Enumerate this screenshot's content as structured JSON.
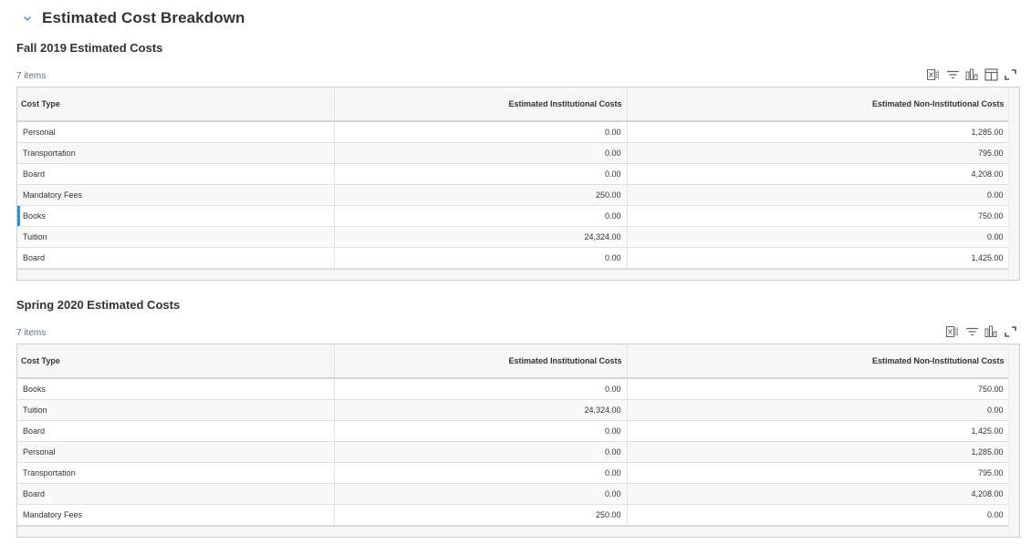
{
  "section": {
    "title": "Estimated Cost Breakdown",
    "collapse_icon": "chevron-down-icon",
    "accent_color": "#2f91e6"
  },
  "grids": [
    {
      "title": "Fall 2019 Estimated Costs",
      "item_count": "7 items",
      "toolbar": [
        "export-excel-icon",
        "filter-icon",
        "chart-icon",
        "column-layout-icon",
        "fullscreen-icon"
      ],
      "columns": [
        "Cost Type",
        "Estimated Institutional Costs",
        "Estimated Non-Institutional Costs"
      ],
      "rows": [
        {
          "cost_type": "Personal",
          "institutional": "0.00",
          "non_institutional": "1,285.00"
        },
        {
          "cost_type": "Transportation",
          "institutional": "0.00",
          "non_institutional": "795.00"
        },
        {
          "cost_type": "Board",
          "institutional": "0.00",
          "non_institutional": "4,208.00"
        },
        {
          "cost_type": "Mandatory Fees",
          "institutional": "250.00",
          "non_institutional": "0.00"
        },
        {
          "cost_type": "Books",
          "institutional": "0.00",
          "non_institutional": "750.00",
          "selected": true
        },
        {
          "cost_type": "Tuition",
          "institutional": "24,324.00",
          "non_institutional": "0.00"
        },
        {
          "cost_type": "Board",
          "institutional": "0.00",
          "non_institutional": "1,425.00"
        }
      ]
    },
    {
      "title": "Spring 2020 Estimated Costs",
      "item_count": "7 items",
      "toolbar": [
        "export-excel-icon",
        "filter-icon",
        "chart-icon",
        "fullscreen-icon"
      ],
      "columns": [
        "Cost Type",
        "Estimated Institutional Costs",
        "Estimated Non-Institutional Costs"
      ],
      "rows": [
        {
          "cost_type": "Books",
          "institutional": "0.00",
          "non_institutional": "750.00"
        },
        {
          "cost_type": "Tuition",
          "institutional": "24,324.00",
          "non_institutional": "0.00"
        },
        {
          "cost_type": "Board",
          "institutional": "0.00",
          "non_institutional": "1,425.00"
        },
        {
          "cost_type": "Personal",
          "institutional": "0.00",
          "non_institutional": "1,285.00"
        },
        {
          "cost_type": "Transportation",
          "institutional": "0.00",
          "non_institutional": "795.00"
        },
        {
          "cost_type": "Board",
          "institutional": "0.00",
          "non_institutional": "4,208.00"
        },
        {
          "cost_type": "Mandatory Fees",
          "institutional": "250.00",
          "non_institutional": "0.00"
        }
      ]
    }
  ]
}
